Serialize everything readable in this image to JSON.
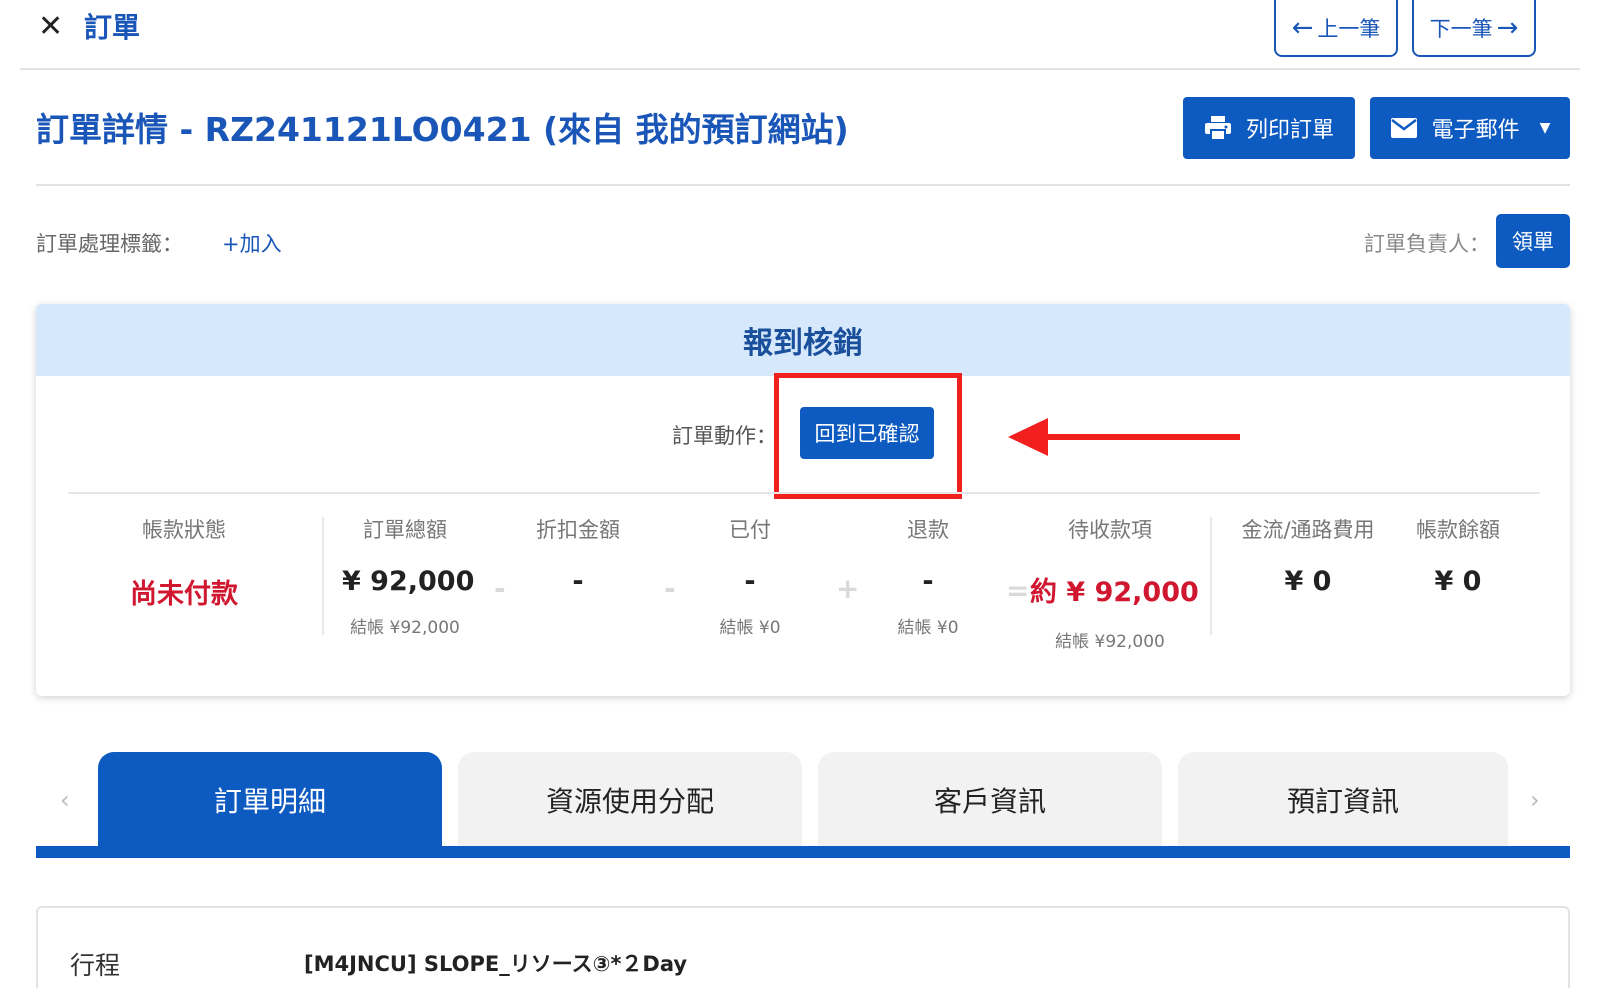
{
  "topbar": {
    "close_icon": "close-icon",
    "title": "訂單",
    "prev_label": "上一筆",
    "next_label": "下一筆"
  },
  "header": {
    "title": "訂單詳情  - RZ241121LO0421 (來自 我的預訂網站)",
    "print_label": "列印訂單",
    "email_label": "電子郵件"
  },
  "tags": {
    "label": "訂單處理標籤：",
    "add_label": "+加入",
    "owner_label": "訂單負責人：",
    "claim_label": "領單"
  },
  "card": {
    "title": "報到核銷",
    "action_label": "訂單動作：",
    "action_button": "回到已確認",
    "columns": [
      {
        "label": "帳款狀態",
        "value": "尚未付款",
        "sub": ""
      },
      {
        "label": "訂單總額",
        "value": "¥ 92,000",
        "sub": "結帳 ¥92,000"
      },
      {
        "label": "折扣金額",
        "value": "-",
        "sub": ""
      },
      {
        "label": "已付",
        "value": "-",
        "sub": "結帳 ¥0"
      },
      {
        "label": "退款",
        "value": "-",
        "sub": "結帳 ¥0"
      },
      {
        "label": "待收款項",
        "value": "約 ¥ 92,000",
        "sub": "結帳 ¥92,000"
      },
      {
        "label": "金流/通路費用",
        "value": "¥ 0",
        "sub": ""
      },
      {
        "label": "帳款餘額",
        "value": "¥ 0",
        "sub": ""
      }
    ],
    "operators": [
      "-",
      "-",
      "+",
      "="
    ]
  },
  "tabs": [
    {
      "label": "訂單明細",
      "active": true
    },
    {
      "label": "資源使用分配",
      "active": false
    },
    {
      "label": "客戶資訊",
      "active": false
    },
    {
      "label": "預訂資訊",
      "active": false
    }
  ],
  "details": {
    "label": "行程",
    "value": "[M4JNCU] SLOPE_リソース③*２Day"
  },
  "colors": {
    "primary": "#0d5ac0",
    "title_blue": "#1a56b8",
    "header_bg": "#d6e8fb",
    "alert_red": "#d0172f",
    "annotation_red": "#f21f1f"
  }
}
